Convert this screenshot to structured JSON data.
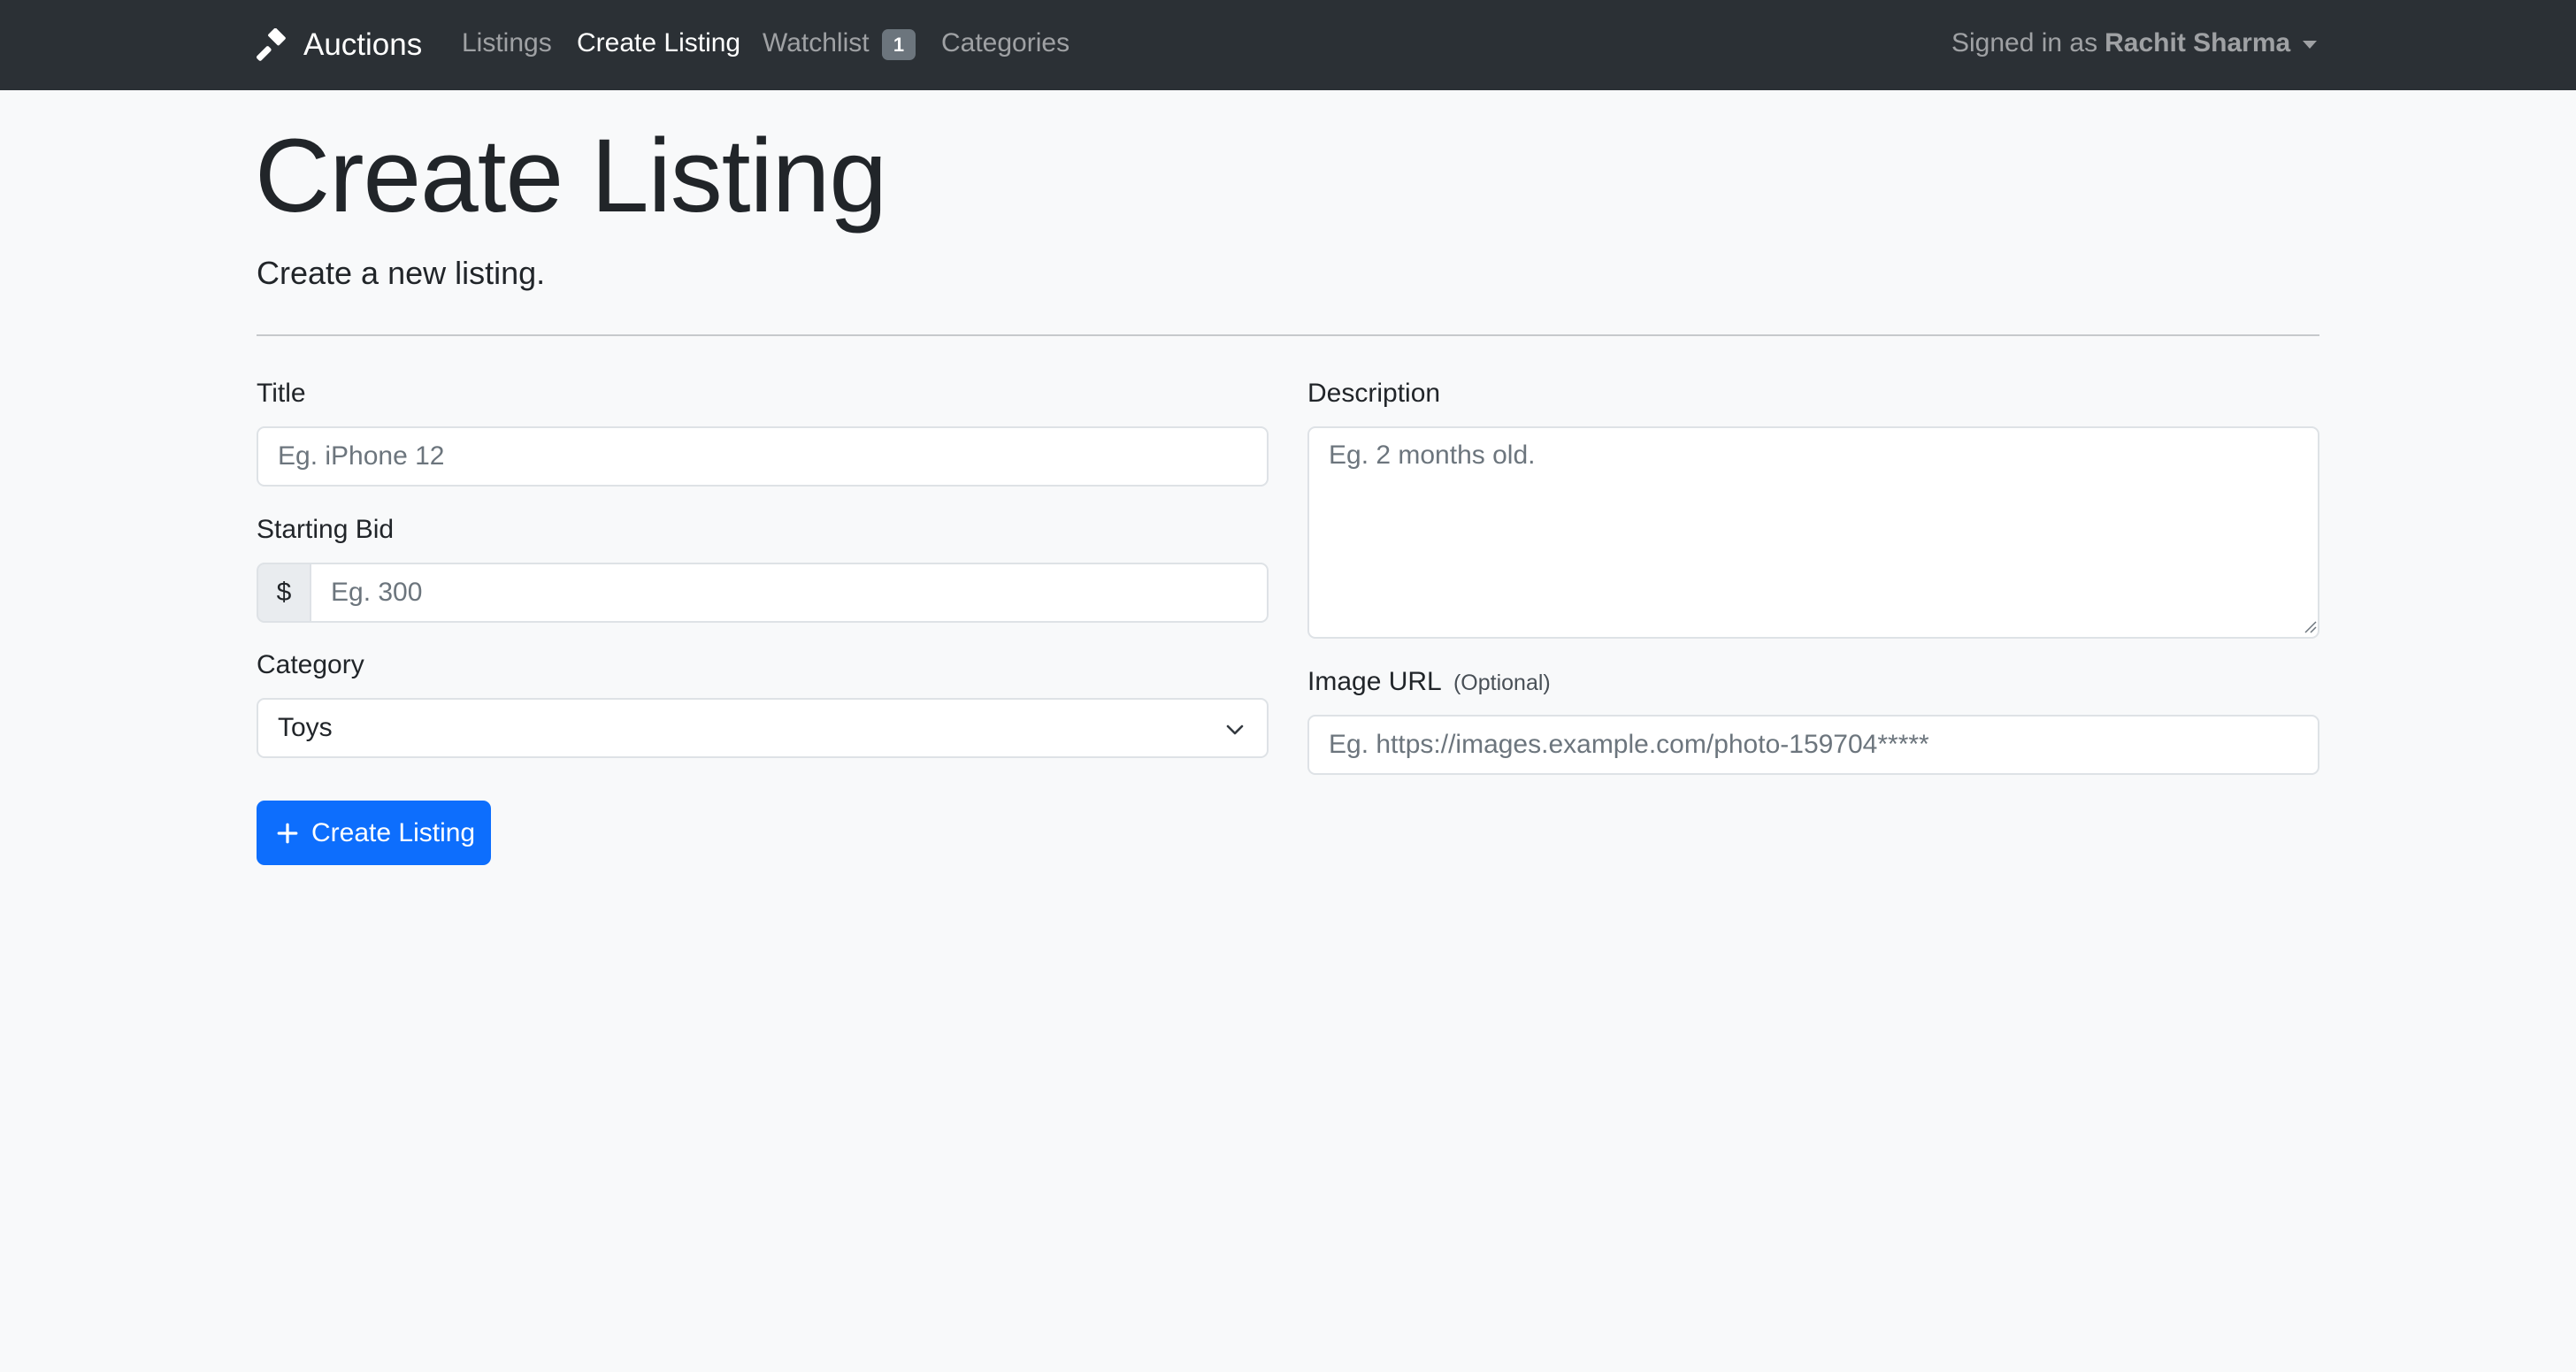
{
  "navbar": {
    "brand": "Auctions",
    "links": {
      "listings": "Listings",
      "create_listing": "Create Listing",
      "watchlist": "Watchlist",
      "categories": "Categories"
    },
    "watchlist_count": "1",
    "user": {
      "prefix": "Signed in as",
      "name": "Rachit Sharma"
    }
  },
  "header": {
    "title": "Create Listing",
    "subtitle": "Create a new listing."
  },
  "form": {
    "title": {
      "label": "Title",
      "placeholder": "Eg. iPhone 12"
    },
    "starting_bid": {
      "label": "Starting Bid",
      "currency": "$",
      "placeholder": "Eg. 300"
    },
    "category": {
      "label": "Category",
      "selected": "Toys"
    },
    "description": {
      "label": "Description",
      "placeholder": "Eg. 2 months old."
    },
    "image_url": {
      "label": "Image URL",
      "optional": "(Optional)",
      "placeholder": "Eg. https://images.example.com/photo-159704*****"
    },
    "submit_label": "Create Listing"
  },
  "icons": {
    "brand": "gavel-icon",
    "dropdown": "caret-down-icon",
    "select": "chevron-down-icon",
    "submit": "plus-icon"
  },
  "colors": {
    "navbar_bg": "#2b3035",
    "page_bg": "#f8f9fa",
    "primary": "#0d6efd",
    "badge_bg": "#6c757d"
  }
}
